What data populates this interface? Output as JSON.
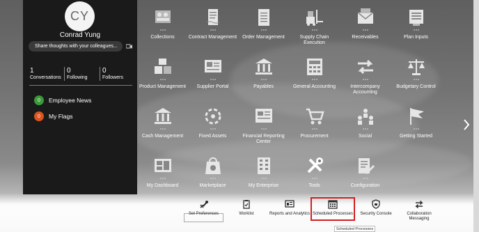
{
  "profile": {
    "initials": "CY",
    "name": "Conrad Yung",
    "share_placeholder": "Share thoughts with your colleagues...",
    "stats": [
      {
        "count": "1",
        "label": "Conversations"
      },
      {
        "count": "0",
        "label": "Following"
      },
      {
        "count": "0",
        "label": "Followers"
      }
    ],
    "feeds": [
      {
        "count": "0",
        "label": "Employee News",
        "color": "#3a9a3a"
      },
      {
        "count": "0",
        "label": "My Flags",
        "color": "#d9541e"
      }
    ]
  },
  "tiles": [
    {
      "label": "Collections",
      "icon": "collections-icon"
    },
    {
      "label": "Contract Management",
      "icon": "contract-management-icon"
    },
    {
      "label": "Order Management",
      "icon": "order-management-icon"
    },
    {
      "label": "Supply Chain Execution",
      "icon": "supply-chain-icon"
    },
    {
      "label": "Receivables",
      "icon": "receivables-icon"
    },
    {
      "label": "Plan Inputs",
      "icon": "plan-inputs-icon"
    },
    {
      "label": "Product Management",
      "icon": "product-management-icon"
    },
    {
      "label": "Supplier Portal",
      "icon": "supplier-portal-icon"
    },
    {
      "label": "Payables",
      "icon": "payables-icon"
    },
    {
      "label": "General Accounting",
      "icon": "general-accounting-icon"
    },
    {
      "label": "Intercompany Accounting",
      "icon": "intercompany-icon"
    },
    {
      "label": "Budgetary Control",
      "icon": "budgetary-control-icon"
    },
    {
      "label": "Cash Management",
      "icon": "cash-management-icon"
    },
    {
      "label": "Fixed Assets",
      "icon": "fixed-assets-icon"
    },
    {
      "label": "Financial Reporting Center",
      "icon": "financial-reporting-icon"
    },
    {
      "label": "Procurement",
      "icon": "procurement-icon"
    },
    {
      "label": "Social",
      "icon": "social-icon"
    },
    {
      "label": "Getting Started",
      "icon": "getting-started-icon"
    },
    {
      "label": "My Dashboard",
      "icon": "my-dashboard-icon"
    },
    {
      "label": "Marketplace",
      "icon": "marketplace-icon"
    },
    {
      "label": "My Enterprise",
      "icon": "my-enterprise-icon"
    },
    {
      "label": "Tools",
      "icon": "tools-icon"
    },
    {
      "label": "Configuration",
      "icon": "configuration-icon"
    }
  ],
  "bottom": [
    {
      "label": "Set Preferences",
      "icon": "set-preferences-icon"
    },
    {
      "label": "Worklist",
      "icon": "worklist-icon"
    },
    {
      "label": "Reports and Analytics",
      "icon": "reports-analytics-icon"
    },
    {
      "label": "Scheduled Processes",
      "icon": "scheduled-processes-icon"
    },
    {
      "label": "Security Console",
      "icon": "security-console-icon"
    },
    {
      "label": "Collaboration Messaging",
      "icon": "collaboration-messaging-icon"
    }
  ],
  "tooltip": "Scheduled Processes",
  "colors": {
    "highlight": "#d21f1f",
    "panel": "#1a1a1a"
  }
}
